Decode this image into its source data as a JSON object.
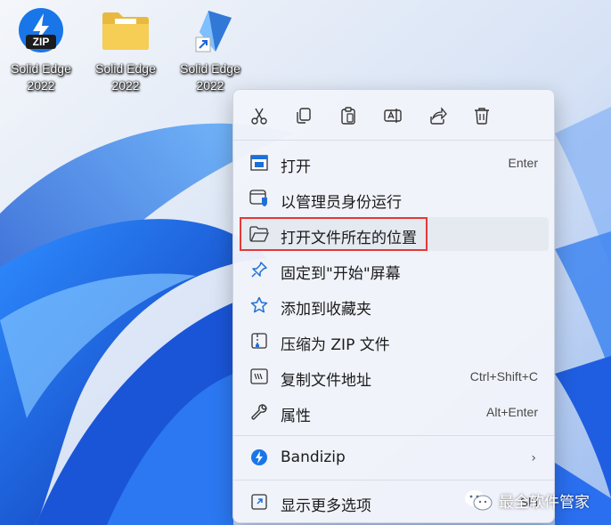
{
  "desktop": {
    "icons": [
      {
        "label_line1": "Solid Edge",
        "label_line2": "2022",
        "icon": "bandizip-zip-icon"
      },
      {
        "label_line1": "Solid Edge",
        "label_line2": "2022",
        "icon": "folder-icon"
      },
      {
        "label_line1": "Solid Edge",
        "label_line2": "2022",
        "icon": "solid-edge-shortcut-icon"
      }
    ]
  },
  "context_menu": {
    "toolbar": [
      {
        "name": "cut",
        "icon": "scissors-icon"
      },
      {
        "name": "copy",
        "icon": "copy-icon"
      },
      {
        "name": "paste",
        "icon": "clipboard-icon"
      },
      {
        "name": "rename",
        "icon": "rename-icon"
      },
      {
        "name": "share",
        "icon": "share-icon"
      },
      {
        "name": "delete",
        "icon": "trash-icon"
      }
    ],
    "items": [
      {
        "label": "打开",
        "shortcut": "Enter",
        "icon": "open-window-icon"
      },
      {
        "label": "以管理员身份运行",
        "shortcut": "",
        "icon": "shield-window-icon"
      },
      {
        "label": "打开文件所在的位置",
        "shortcut": "",
        "icon": "folder-open-icon"
      },
      {
        "label": "固定到\"开始\"屏幕",
        "shortcut": "",
        "icon": "pin-icon"
      },
      {
        "label": "添加到收藏夹",
        "shortcut": "",
        "icon": "star-icon"
      },
      {
        "label": "压缩为 ZIP 文件",
        "shortcut": "",
        "icon": "zip-file-icon"
      },
      {
        "label": "复制文件地址",
        "shortcut": "Ctrl+Shift+C",
        "icon": "copy-path-icon"
      },
      {
        "label": "属性",
        "shortcut": "Alt+Enter",
        "icon": "wrench-icon"
      },
      {
        "label": "Bandizip",
        "shortcut": "",
        "icon": "bandizip-icon",
        "submenu_arrow": "›"
      },
      {
        "label": "显示更多选项",
        "shortcut": "Shi",
        "icon": "more-options-icon"
      }
    ],
    "highlighted_item": "打开文件所在的位置"
  },
  "watermark": {
    "text": "最全软件管家",
    "icon": "wechat-icon"
  },
  "colors": {
    "accent": "#0a68d8",
    "highlight_border": "#e53935"
  }
}
